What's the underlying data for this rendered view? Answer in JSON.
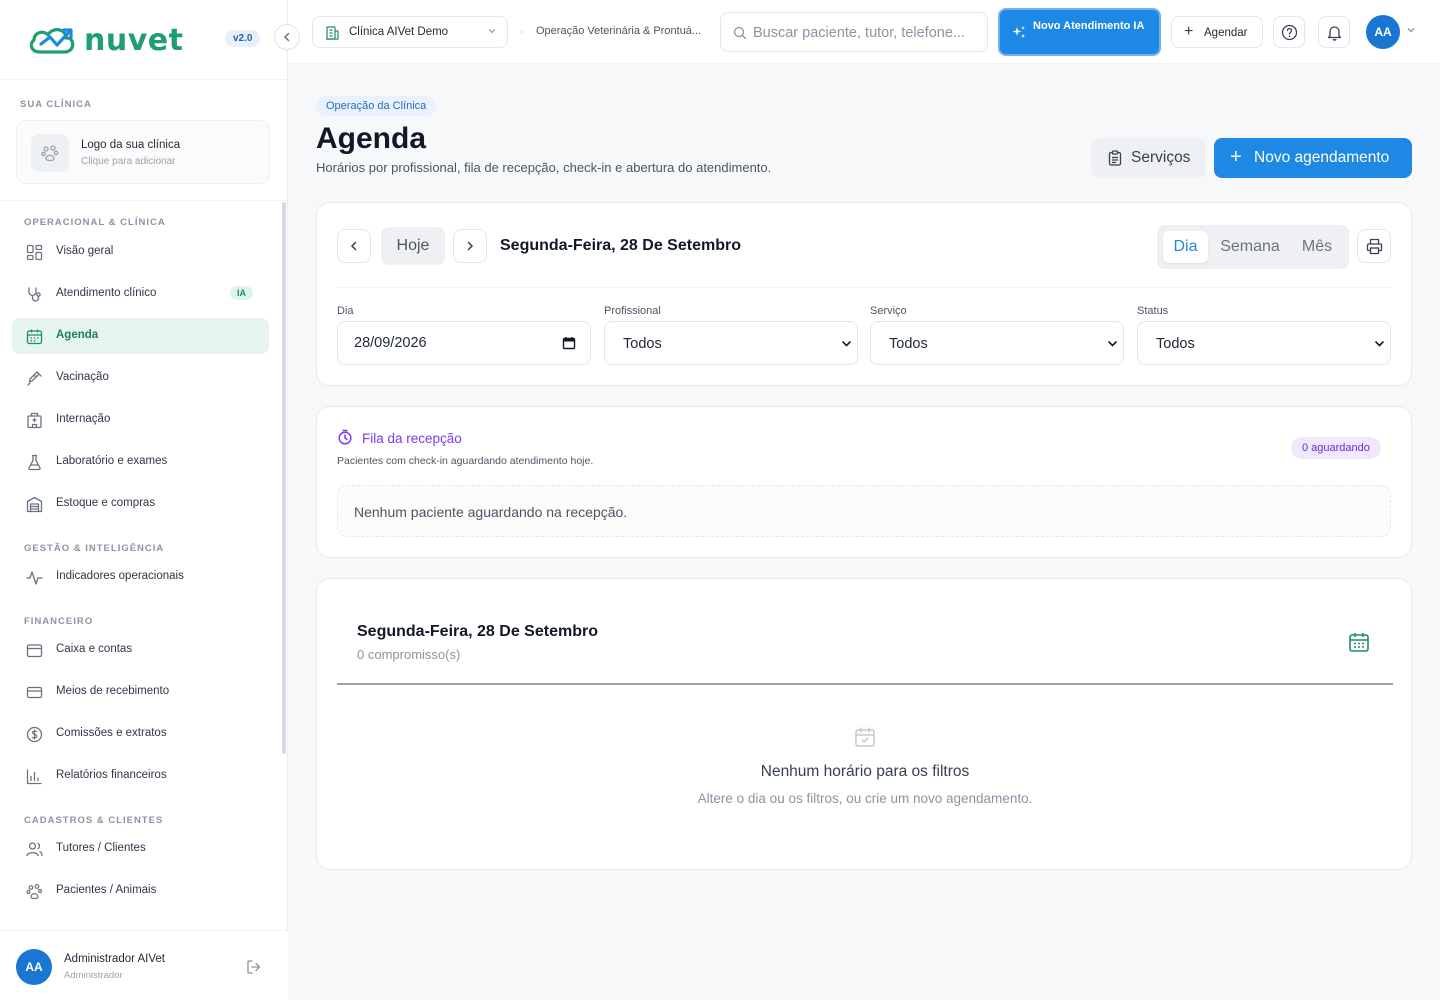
{
  "app": {
    "brand": "nuvet",
    "version": "v2.0"
  },
  "sidebar": {
    "sections": {
      "your_clinic": "SUA CLÍNICA",
      "operational": "OPERACIONAL & CLÍNICA",
      "management": "GESTÃO & INTELIGÊNCIA",
      "financial": "FINANCEIRO",
      "records": "CADASTROS & CLIENTES"
    },
    "clinic_card": {
      "title": "Logo da sua clínica",
      "subtitle": "Clique para adicionar"
    },
    "items": [
      {
        "label": "Visão geral",
        "icon": "grid-icon"
      },
      {
        "label": "Atendimento clínico",
        "icon": "stethoscope-icon",
        "badge": "IA"
      },
      {
        "label": "Agenda",
        "icon": "calendar-icon",
        "active": true
      },
      {
        "label": "Vacinação",
        "icon": "syringe-icon"
      },
      {
        "label": "Internação",
        "icon": "hospital-icon"
      },
      {
        "label": "Laboratório e exames",
        "icon": "flask-icon"
      },
      {
        "label": "Estoque e compras",
        "icon": "warehouse-icon"
      },
      {
        "label": "Indicadores operacionais",
        "icon": "activity-icon"
      },
      {
        "label": "Caixa e contas",
        "icon": "wallet-icon"
      },
      {
        "label": "Meios de recebimento",
        "icon": "credit-card-icon"
      },
      {
        "label": "Comissões e extratos",
        "icon": "dollar-circle-icon"
      },
      {
        "label": "Relatórios financeiros",
        "icon": "bar-chart-icon"
      },
      {
        "label": "Tutores / Clientes",
        "icon": "users-icon"
      },
      {
        "label": "Pacientes / Animais",
        "icon": "paw-icon"
      }
    ],
    "user": {
      "initials": "AA",
      "name": "Administrador AIVet",
      "role": "Administrador"
    }
  },
  "topbar": {
    "clinic": "Clínica AIVet Demo",
    "breadcrumb": "Operação Veterinária & Prontuá...",
    "search_placeholder": "Buscar paciente, tutor, telefone...",
    "new_ai_label": "Novo Atendimento IA",
    "schedule_label": "Agendar",
    "avatar_initials": "AA"
  },
  "page": {
    "chip": "Operação da Clínica",
    "title": "Agenda",
    "subtitle": "Horários por profissional, fila de recepção, check-in e abertura do atendimento.",
    "services_label": "Serviços",
    "new_appointment_label": "Novo agendamento"
  },
  "calendar": {
    "today_label": "Hoje",
    "current_date": "Segunda-Feira, 28 De Setembro",
    "views": [
      "Dia",
      "Semana",
      "Mês"
    ],
    "active_view": "Dia"
  },
  "filters": {
    "day": {
      "label": "Dia",
      "value": "28/09/2026"
    },
    "professional": {
      "label": "Profissional",
      "value": "Todos"
    },
    "service": {
      "label": "Serviço",
      "value": "Todos"
    },
    "status": {
      "label": "Status",
      "value": "Todos"
    }
  },
  "queue": {
    "title": "Fila da recepção",
    "subtitle": "Pacientes com check-in aguardando atendimento hoje.",
    "badge": "0 aguardando",
    "empty": "Nenhum paciente aguardando na recepção."
  },
  "day_view": {
    "title": "Segunda-Feira, 28 De Setembro",
    "count": "0 compromisso(s)",
    "empty_title": "Nenhum horário para os filtros",
    "empty_subtitle": "Altere o dia ou os filtros, ou crie um novo agendamento."
  },
  "colors": {
    "brand_green": "#1f9d77",
    "primary_blue": "#1e88e5",
    "queue_purple": "#7c3aed",
    "active_nav_bg": "#e6f5ef"
  }
}
